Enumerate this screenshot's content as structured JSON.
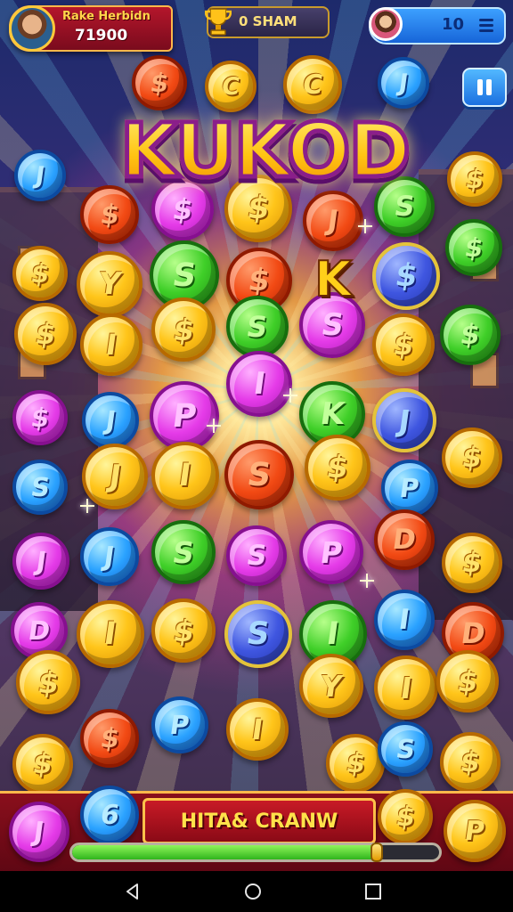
{
  "hud": {
    "player_name": "Rake Herbidn",
    "player_score": "71900",
    "trophy_text": "0 SHAM",
    "count": "10"
  },
  "title": {
    "logo": "KUKOD",
    "floating_letter": "K"
  },
  "board": {
    "coins": [
      {
        "c": "red",
        "l": "$"
      },
      {
        "c": "gold",
        "l": "C"
      },
      {
        "c": "gold",
        "l": "C"
      },
      {
        "c": "blue",
        "l": "J"
      },
      {
        "c": "blue",
        "l": "J"
      },
      {
        "c": "red",
        "l": "$"
      },
      {
        "c": "pink",
        "l": "$"
      },
      {
        "c": "gold",
        "l": "$"
      },
      {
        "c": "red",
        "l": "J"
      },
      {
        "c": "green",
        "l": "S"
      },
      {
        "c": "gold",
        "l": "$"
      },
      {
        "c": "gold",
        "l": "$"
      },
      {
        "c": "gold",
        "l": "Y"
      },
      {
        "c": "green",
        "l": "S"
      },
      {
        "c": "red",
        "l": "$"
      },
      {
        "c": "navy",
        "l": "$"
      },
      {
        "c": "green",
        "l": "$"
      },
      {
        "c": "gold",
        "l": "$"
      },
      {
        "c": "gold",
        "l": "I"
      },
      {
        "c": "gold",
        "l": "$"
      },
      {
        "c": "green",
        "l": "S"
      },
      {
        "c": "pink",
        "l": "S"
      },
      {
        "c": "gold",
        "l": "$"
      },
      {
        "c": "green",
        "l": "$"
      },
      {
        "c": "pink",
        "l": "I"
      },
      {
        "c": "pink",
        "l": "$"
      },
      {
        "c": "blue",
        "l": "J"
      },
      {
        "c": "pink",
        "l": "P"
      },
      {
        "c": "green",
        "l": "K"
      },
      {
        "c": "navy",
        "l": "J"
      },
      {
        "c": "blue",
        "l": "S"
      },
      {
        "c": "gold",
        "l": "J"
      },
      {
        "c": "gold",
        "l": "I"
      },
      {
        "c": "red",
        "l": "S"
      },
      {
        "c": "gold",
        "l": "$"
      },
      {
        "c": "blue",
        "l": "P"
      },
      {
        "c": "gold",
        "l": "$"
      },
      {
        "c": "pink",
        "l": "J"
      },
      {
        "c": "blue",
        "l": "J"
      },
      {
        "c": "green",
        "l": "S"
      },
      {
        "c": "pink",
        "l": "S"
      },
      {
        "c": "pink",
        "l": "P"
      },
      {
        "c": "red",
        "l": "D"
      },
      {
        "c": "gold",
        "l": "$"
      },
      {
        "c": "pink",
        "l": "D"
      },
      {
        "c": "gold",
        "l": "I"
      },
      {
        "c": "gold",
        "l": "$"
      },
      {
        "c": "navy",
        "l": "S"
      },
      {
        "c": "green",
        "l": "I"
      },
      {
        "c": "blue",
        "l": "I"
      },
      {
        "c": "red",
        "l": "D"
      },
      {
        "c": "gold",
        "l": "$"
      },
      {
        "c": "gold",
        "l": "Y"
      },
      {
        "c": "gold",
        "l": "I"
      },
      {
        "c": "gold",
        "l": "$"
      },
      {
        "c": "gold",
        "l": "$"
      },
      {
        "c": "red",
        "l": "$"
      },
      {
        "c": "blue",
        "l": "P"
      },
      {
        "c": "gold",
        "l": "I"
      },
      {
        "c": "gold",
        "l": "$"
      },
      {
        "c": "blue",
        "l": "S"
      },
      {
        "c": "gold",
        "l": "$"
      }
    ]
  },
  "bottom": {
    "left_coin": "J",
    "second_coin": "6",
    "right_coin": "P",
    "banner": "HITA& CRANW",
    "progress": 0.83
  },
  "colors": {
    "hud_red": "#b4162b",
    "hud_blue": "#1765d8",
    "accent_gold": "#ffc413",
    "progress_green": "#2fb51c"
  },
  "icons": [
    "avatar",
    "trophy-icon",
    "menu-icon",
    "pause-icon",
    "back-icon",
    "home-icon",
    "recents-icon"
  ]
}
